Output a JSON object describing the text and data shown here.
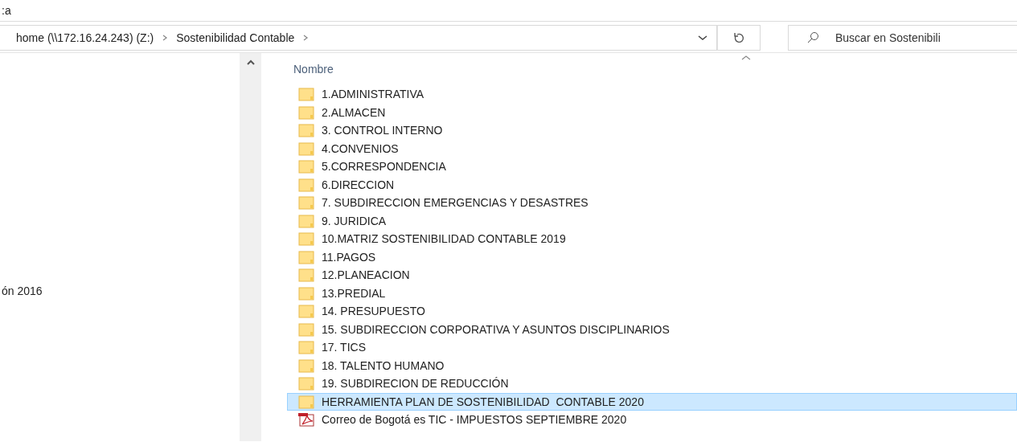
{
  "title_fragment": ":a",
  "address_bar": {
    "segments": [
      "home (\\\\172.16.24.243) (Z:)",
      "Sostenibilidad Contable"
    ]
  },
  "search": {
    "placeholder": "Buscar en Sostenibili"
  },
  "navigation_pane": {
    "items": [
      "ón 2016"
    ]
  },
  "file_list": {
    "columns": [
      "Nombre"
    ],
    "items": [
      {
        "name": "1.ADMINISTRATIVA",
        "kind": "folder",
        "selected": false
      },
      {
        "name": "2.ALMACEN",
        "kind": "folder",
        "selected": false
      },
      {
        "name": "3. CONTROL INTERNO",
        "kind": "folder",
        "selected": false
      },
      {
        "name": "4.CONVENIOS",
        "kind": "folder",
        "selected": false
      },
      {
        "name": "5.CORRESPONDENCIA",
        "kind": "folder",
        "selected": false
      },
      {
        "name": "6.DIRECCION",
        "kind": "folder",
        "selected": false
      },
      {
        "name": "7. SUBDIRECCION EMERGENCIAS Y DESASTRES",
        "kind": "folder",
        "selected": false
      },
      {
        "name": "9. JURIDICA",
        "kind": "folder",
        "selected": false
      },
      {
        "name": "10.MATRIZ SOSTENIBILIDAD CONTABLE 2019",
        "kind": "folder",
        "selected": false
      },
      {
        "name": "11.PAGOS",
        "kind": "folder",
        "selected": false
      },
      {
        "name": "12.PLANEACION",
        "kind": "folder",
        "selected": false
      },
      {
        "name": "13.PREDIAL",
        "kind": "folder",
        "selected": false
      },
      {
        "name": "14. PRESUPUESTO",
        "kind": "folder",
        "selected": false
      },
      {
        "name": "15. SUBDIRECCION CORPORATIVA Y ASUNTOS DISCIPLINARIOS",
        "kind": "folder",
        "selected": false
      },
      {
        "name": "17. TICS",
        "kind": "folder",
        "selected": false
      },
      {
        "name": "18. TALENTO HUMANO",
        "kind": "folder",
        "selected": false
      },
      {
        "name": "19. SUBDIRECION DE REDUCCIÓN",
        "kind": "folder",
        "selected": false
      },
      {
        "name": "HERRAMIENTA PLAN DE SOSTENIBILIDAD  CONTABLE 2020",
        "kind": "folder",
        "selected": true
      },
      {
        "name": "Correo de Bogotá es TIC - IMPUESTOS SEPTIEMBRE 2020",
        "kind": "pdf",
        "selected": false
      }
    ]
  }
}
